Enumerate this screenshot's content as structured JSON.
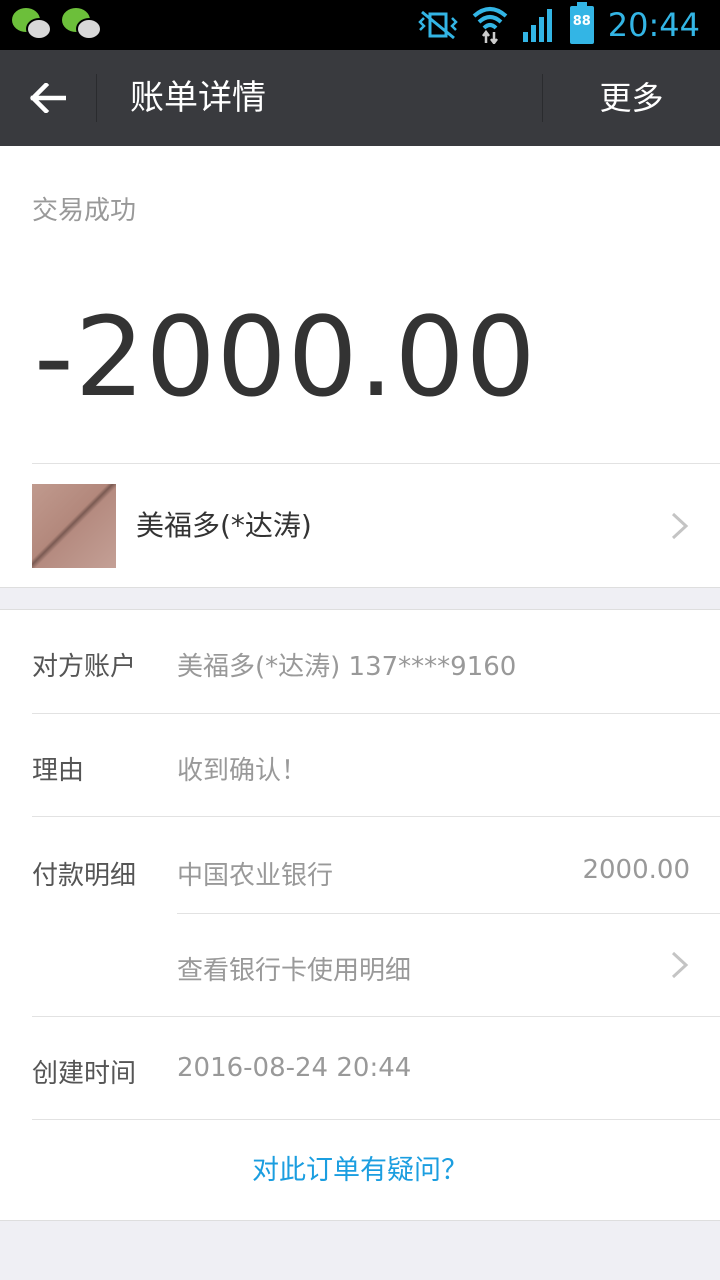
{
  "status_bar": {
    "time": "20:44",
    "battery": "88",
    "notification_icons": [
      "wechat-icon",
      "wechat-icon"
    ],
    "system_icons": [
      "vibrate-icon",
      "wifi-icon",
      "signal-icon",
      "battery-icon"
    ],
    "accent_color": "#33b5e5"
  },
  "header": {
    "title": "账单详情",
    "more_label": "更多"
  },
  "summary": {
    "status": "交易成功",
    "amount": "-2000.00",
    "merchant_name": "美福多(*达涛)"
  },
  "details": {
    "account": {
      "label": "对方账户",
      "value": "美福多(*达涛) 137****9160"
    },
    "reason": {
      "label": "理由",
      "value": "收到确认！"
    },
    "payment": {
      "label": "付款明细",
      "bank": "中国农业银行",
      "amount": "2000.00",
      "view_link": "查看银行卡使用明细"
    },
    "created": {
      "label": "创建时间",
      "value": "2016-08-24 20:44"
    },
    "question_link": "对此订单有疑问？"
  },
  "colors": {
    "header_bg": "#393a3e",
    "link": "#1b9ee0",
    "page_bg": "#efeff4"
  }
}
